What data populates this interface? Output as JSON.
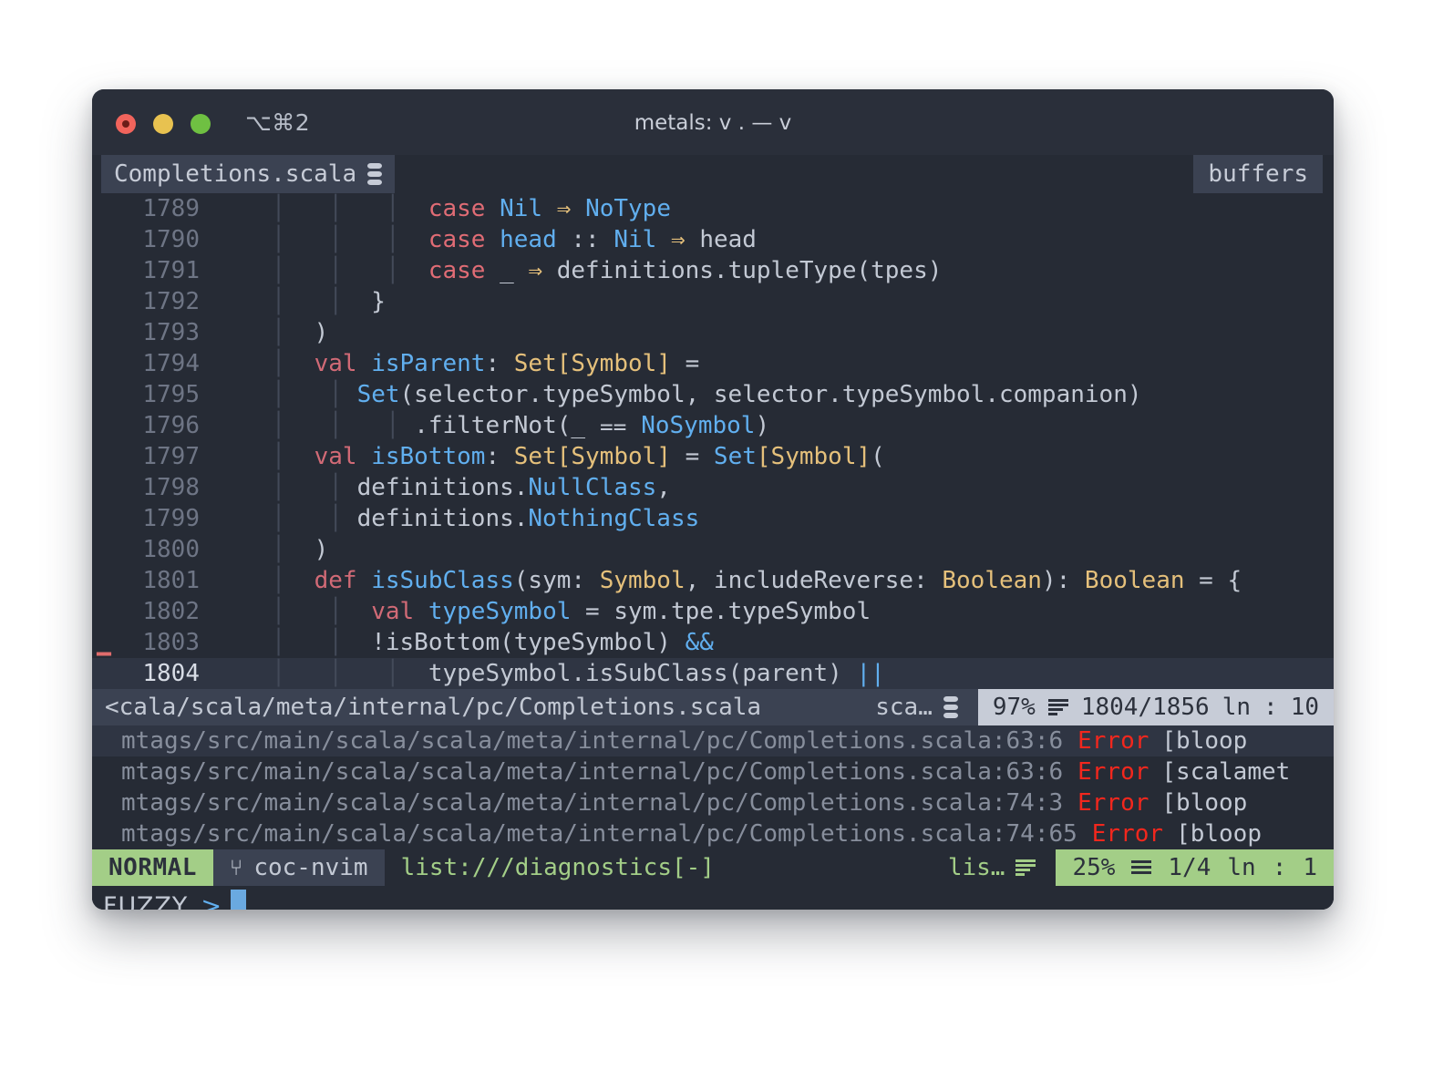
{
  "window": {
    "shortcut": "⌥⌘2",
    "title": "metals: v . — v",
    "traffic_lights": [
      "close-red",
      "minimize-yellow",
      "maximize-green"
    ]
  },
  "tabline": {
    "active_tab": "Completions.scala",
    "active_tab_icon": "scala-icon",
    "right_tab": "buffers"
  },
  "editor": {
    "lines": [
      {
        "num": "1789",
        "sign": "",
        "cursor": false,
        "segments": [
          {
            "t": "    ",
            "c": "pl"
          },
          {
            "t": "│ ",
            "c": "ind"
          },
          {
            "t": "  ",
            "c": "pl"
          },
          {
            "t": "│ ",
            "c": "ind"
          },
          {
            "t": "  ",
            "c": "pl"
          },
          {
            "t": "│ ",
            "c": "ind"
          },
          {
            "t": " ",
            "c": "pl"
          },
          {
            "t": "case",
            "c": "kw"
          },
          {
            "t": " ",
            "c": "pl"
          },
          {
            "t": "Nil",
            "c": "id"
          },
          {
            "t": " ",
            "c": "pl"
          },
          {
            "t": "⇒",
            "c": "op"
          },
          {
            "t": " ",
            "c": "pl"
          },
          {
            "t": "NoType",
            "c": "id"
          }
        ]
      },
      {
        "num": "1790",
        "sign": "",
        "cursor": false,
        "segments": [
          {
            "t": "    ",
            "c": "pl"
          },
          {
            "t": "│ ",
            "c": "ind"
          },
          {
            "t": "  ",
            "c": "pl"
          },
          {
            "t": "│ ",
            "c": "ind"
          },
          {
            "t": "  ",
            "c": "pl"
          },
          {
            "t": "│ ",
            "c": "ind"
          },
          {
            "t": " ",
            "c": "pl"
          },
          {
            "t": "case",
            "c": "kw"
          },
          {
            "t": " ",
            "c": "pl"
          },
          {
            "t": "head",
            "c": "id"
          },
          {
            "t": " ",
            "c": "pl"
          },
          {
            "t": "::",
            "c": "pl"
          },
          {
            "t": " ",
            "c": "pl"
          },
          {
            "t": "Nil",
            "c": "id"
          },
          {
            "t": " ",
            "c": "pl"
          },
          {
            "t": "⇒",
            "c": "op"
          },
          {
            "t": " ",
            "c": "pl"
          },
          {
            "t": "head",
            "c": "pl"
          }
        ]
      },
      {
        "num": "1791",
        "sign": "",
        "cursor": false,
        "segments": [
          {
            "t": "    ",
            "c": "pl"
          },
          {
            "t": "│ ",
            "c": "ind"
          },
          {
            "t": "  ",
            "c": "pl"
          },
          {
            "t": "│ ",
            "c": "ind"
          },
          {
            "t": "  ",
            "c": "pl"
          },
          {
            "t": "│ ",
            "c": "ind"
          },
          {
            "t": " ",
            "c": "pl"
          },
          {
            "t": "case",
            "c": "kw"
          },
          {
            "t": " ",
            "c": "pl"
          },
          {
            "t": "_",
            "c": "pl"
          },
          {
            "t": " ",
            "c": "pl"
          },
          {
            "t": "⇒",
            "c": "op"
          },
          {
            "t": " ",
            "c": "pl"
          },
          {
            "t": "definitions.tupleType(tpes)",
            "c": "pl"
          }
        ]
      },
      {
        "num": "1792",
        "sign": "",
        "cursor": false,
        "segments": [
          {
            "t": "    ",
            "c": "pl"
          },
          {
            "t": "│ ",
            "c": "ind"
          },
          {
            "t": "  ",
            "c": "pl"
          },
          {
            "t": "│ ",
            "c": "ind"
          },
          {
            "t": " ",
            "c": "pl"
          },
          {
            "t": "}",
            "c": "pl"
          }
        ]
      },
      {
        "num": "1793",
        "sign": "",
        "cursor": false,
        "segments": [
          {
            "t": "    ",
            "c": "pl"
          },
          {
            "t": "│ ",
            "c": "ind"
          },
          {
            "t": " ",
            "c": "pl"
          },
          {
            "t": ")",
            "c": "pl"
          }
        ]
      },
      {
        "num": "1794",
        "sign": "",
        "cursor": false,
        "segments": [
          {
            "t": "    ",
            "c": "pl"
          },
          {
            "t": "│ ",
            "c": "ind"
          },
          {
            "t": " ",
            "c": "pl"
          },
          {
            "t": "val",
            "c": "kw2"
          },
          {
            "t": " ",
            "c": "pl"
          },
          {
            "t": "isParent",
            "c": "id"
          },
          {
            "t": ": ",
            "c": "pl"
          },
          {
            "t": "Set[Symbol]",
            "c": "typ"
          },
          {
            "t": " = ",
            "c": "pl"
          }
        ]
      },
      {
        "num": "1795",
        "sign": "",
        "cursor": false,
        "segments": [
          {
            "t": "    ",
            "c": "pl"
          },
          {
            "t": "│ ",
            "c": "ind"
          },
          {
            "t": "  ",
            "c": "pl"
          },
          {
            "t": "│ ",
            "c": "ind"
          },
          {
            "t": "Set",
            "c": "id"
          },
          {
            "t": "(selector.typeSymbol, selector.typeSymbol.companion)",
            "c": "pl"
          }
        ]
      },
      {
        "num": "1796",
        "sign": "",
        "cursor": false,
        "segments": [
          {
            "t": "    ",
            "c": "pl"
          },
          {
            "t": "│ ",
            "c": "ind"
          },
          {
            "t": "  ",
            "c": "pl"
          },
          {
            "t": "│ ",
            "c": "ind"
          },
          {
            "t": "  ",
            "c": "pl"
          },
          {
            "t": "│ ",
            "c": "ind"
          },
          {
            "t": ".filterNot(_ ",
            "c": "pl"
          },
          {
            "t": "⩵",
            "c": "pl"
          },
          {
            "t": " ",
            "c": "pl"
          },
          {
            "t": "NoSymbol",
            "c": "id"
          },
          {
            "t": ")",
            "c": "pl"
          }
        ]
      },
      {
        "num": "1797",
        "sign": "",
        "cursor": false,
        "segments": [
          {
            "t": "    ",
            "c": "pl"
          },
          {
            "t": "│ ",
            "c": "ind"
          },
          {
            "t": " ",
            "c": "pl"
          },
          {
            "t": "val",
            "c": "kw2"
          },
          {
            "t": " ",
            "c": "pl"
          },
          {
            "t": "isBottom",
            "c": "id"
          },
          {
            "t": ": ",
            "c": "pl"
          },
          {
            "t": "Set[Symbol]",
            "c": "typ"
          },
          {
            "t": " = ",
            "c": "pl"
          },
          {
            "t": "Set",
            "c": "id"
          },
          {
            "t": "[",
            "c": "typ"
          },
          {
            "t": "Symbol",
            "c": "typ"
          },
          {
            "t": "]",
            "c": "typ"
          },
          {
            "t": "(",
            "c": "pl"
          }
        ]
      },
      {
        "num": "1798",
        "sign": "",
        "cursor": false,
        "segments": [
          {
            "t": "    ",
            "c": "pl"
          },
          {
            "t": "│ ",
            "c": "ind"
          },
          {
            "t": "  ",
            "c": "pl"
          },
          {
            "t": "│ ",
            "c": "ind"
          },
          {
            "t": "definitions.",
            "c": "pl"
          },
          {
            "t": "NullClass",
            "c": "id"
          },
          {
            "t": ",",
            "c": "pl"
          }
        ]
      },
      {
        "num": "1799",
        "sign": "",
        "cursor": false,
        "segments": [
          {
            "t": "    ",
            "c": "pl"
          },
          {
            "t": "│ ",
            "c": "ind"
          },
          {
            "t": "  ",
            "c": "pl"
          },
          {
            "t": "│ ",
            "c": "ind"
          },
          {
            "t": "definitions.",
            "c": "pl"
          },
          {
            "t": "NothingClass",
            "c": "id"
          }
        ]
      },
      {
        "num": "1800",
        "sign": "",
        "cursor": false,
        "segments": [
          {
            "t": "    ",
            "c": "pl"
          },
          {
            "t": "│ ",
            "c": "ind"
          },
          {
            "t": " ",
            "c": "pl"
          },
          {
            "t": ")",
            "c": "pl"
          }
        ]
      },
      {
        "num": "1801",
        "sign": "",
        "cursor": false,
        "segments": [
          {
            "t": "    ",
            "c": "pl"
          },
          {
            "t": "│ ",
            "c": "ind"
          },
          {
            "t": " ",
            "c": "pl"
          },
          {
            "t": "def",
            "c": "kw2"
          },
          {
            "t": " ",
            "c": "pl"
          },
          {
            "t": "isSubClass",
            "c": "id"
          },
          {
            "t": "(sym: ",
            "c": "pl"
          },
          {
            "t": "Symbol",
            "c": "typ"
          },
          {
            "t": ", includeReverse: ",
            "c": "pl"
          },
          {
            "t": "Boolean",
            "c": "typ"
          },
          {
            "t": "): ",
            "c": "pl"
          },
          {
            "t": "Boolean",
            "c": "typ"
          },
          {
            "t": " = {",
            "c": "pl"
          }
        ]
      },
      {
        "num": "1802",
        "sign": "",
        "cursor": false,
        "segments": [
          {
            "t": "    ",
            "c": "pl"
          },
          {
            "t": "│ ",
            "c": "ind"
          },
          {
            "t": "  ",
            "c": "pl"
          },
          {
            "t": "│ ",
            "c": "ind"
          },
          {
            "t": " ",
            "c": "pl"
          },
          {
            "t": "val",
            "c": "kw2"
          },
          {
            "t": " ",
            "c": "pl"
          },
          {
            "t": "typeSymbol",
            "c": "id"
          },
          {
            "t": " = sym.tpe.typeSymbol",
            "c": "pl"
          }
        ]
      },
      {
        "num": "1803",
        "sign": "▁",
        "cursor": false,
        "segments": [
          {
            "t": "    ",
            "c": "pl"
          },
          {
            "t": "│ ",
            "c": "ind"
          },
          {
            "t": "  ",
            "c": "pl"
          },
          {
            "t": "│ ",
            "c": "ind"
          },
          {
            "t": " ",
            "c": "pl"
          },
          {
            "t": "!isBottom(typeSymbol) ",
            "c": "pl"
          },
          {
            "t": "&&",
            "c": "opb"
          }
        ]
      },
      {
        "num": "1804",
        "sign": "",
        "cursor": true,
        "segments": [
          {
            "t": "    ",
            "c": "pl"
          },
          {
            "t": "│ ",
            "c": "ind"
          },
          {
            "t": "  ",
            "c": "pl"
          },
          {
            "t": "│ ",
            "c": "ind"
          },
          {
            "t": "  ",
            "c": "pl"
          },
          {
            "t": "│ ",
            "c": "ind"
          },
          {
            "t": " ",
            "c": "pl"
          },
          {
            "t": "typeSymbol.isSubClass(parent) ",
            "c": "pl"
          },
          {
            "t": "||",
            "c": "opb"
          }
        ]
      }
    ]
  },
  "file_statusline": {
    "path": "<cala/scala/meta/internal/pc/Completions.scala",
    "filetype": "sca…",
    "filetype_icon": "scala-icon",
    "percent": "97%",
    "lines_icon": "lines-icon",
    "line_ratio": "1804/1856",
    "ln_label": "ln",
    "colon": ":",
    "col": "10"
  },
  "diagnostics": [
    {
      "path": "mtags/src/main/scala/scala/meta/internal/pc/Completions.scala:63:6",
      "severity": "Error",
      "source": "[bloop",
      "active": true
    },
    {
      "path": "mtags/src/main/scala/scala/meta/internal/pc/Completions.scala:63:6",
      "severity": "Error",
      "source": "[scalamet",
      "active": false
    },
    {
      "path": "mtags/src/main/scala/scala/meta/internal/pc/Completions.scala:74:3",
      "severity": "Error",
      "source": "[bloop",
      "active": false
    },
    {
      "path": "mtags/src/main/scala/scala/meta/internal/pc/Completions.scala:74:65",
      "severity": "Error",
      "source": "[bloop",
      "active": false
    }
  ],
  "statusline": {
    "mode": "NORMAL",
    "branch_icon": "git-branch-icon",
    "branch": "coc-nvim",
    "file": "list:///diagnostics[-]",
    "filetype": "lis…",
    "filetype_icon": "lines-icon",
    "percent": "25%",
    "lines_icon": "hamburger-icon",
    "line_ratio": "1/4",
    "ln_label": "ln",
    "colon": ":",
    "col": "1"
  },
  "cmdline": {
    "label": "FUZZY",
    "prompt": ">",
    "value": ""
  },
  "colors": {
    "bg": "#262b35",
    "panel": "#3b4252",
    "accent_green": "#a3ce87",
    "error_red": "#f2271d",
    "keyword": "#e06c75",
    "type": "#e5c07b",
    "identifier": "#61afef",
    "text": "#c3c9d4",
    "linenr": "#6e7585"
  }
}
